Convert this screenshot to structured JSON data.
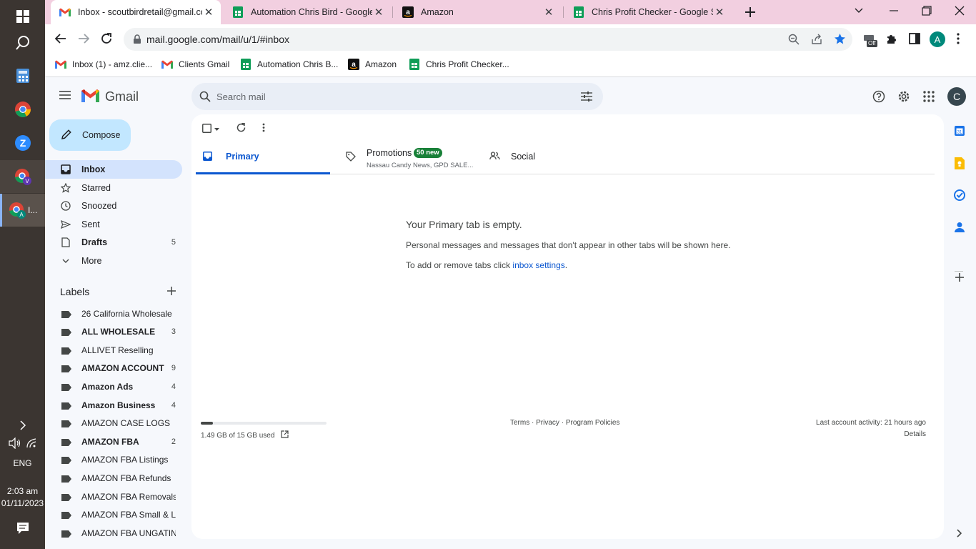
{
  "taskbar": {
    "time": "2:03 am",
    "date": "01/11/2023",
    "language": "ENG",
    "pinned_label": "I..."
  },
  "browser": {
    "tabs": [
      {
        "title": "Inbox - scoutbirdretail@gmail.com",
        "icon": "gmail-icon",
        "active": true
      },
      {
        "title": "Automation Chris Bird - Google",
        "icon": "sheets-icon",
        "active": false
      },
      {
        "title": "Amazon",
        "icon": "amazon-icon",
        "active": false
      },
      {
        "title": "Chris Profit Checker - Google Sh",
        "icon": "sheets-icon",
        "active": false
      }
    ],
    "url": "mail.google.com/mail/u/1/#inbox",
    "profile_initial": "A",
    "extension_badge": "Off",
    "bookmarks": [
      {
        "label": "Inbox (1) - amz.clie...",
        "icon": "gmail-icon"
      },
      {
        "label": "Clients Gmail",
        "icon": "gmail-icon"
      },
      {
        "label": "Automation Chris B...",
        "icon": "sheets-icon"
      },
      {
        "label": "Amazon",
        "icon": "amazon-icon"
      },
      {
        "label": "Chris Profit Checker...",
        "icon": "sheets-icon"
      }
    ]
  },
  "gmail": {
    "logo_text": "Gmail",
    "search_placeholder": "Search mail",
    "account_initial": "C",
    "compose_label": "Compose",
    "nav": [
      {
        "label": "Inbox",
        "icon": "inbox-icon",
        "count": "",
        "active": true
      },
      {
        "label": "Starred",
        "icon": "star-icon",
        "count": "",
        "active": false
      },
      {
        "label": "Snoozed",
        "icon": "clock-icon",
        "count": "",
        "active": false
      },
      {
        "label": "Sent",
        "icon": "send-icon",
        "count": "",
        "active": false
      },
      {
        "label": "Drafts",
        "icon": "draft-icon",
        "count": "5",
        "active": false
      },
      {
        "label": "More",
        "icon": "chevron-down-icon",
        "count": "",
        "active": false
      }
    ],
    "labels_heading": "Labels",
    "labels": [
      {
        "name": "26 California Wholesale",
        "count": "",
        "bold": false
      },
      {
        "name": "ALL WHOLESALE",
        "count": "3",
        "bold": true
      },
      {
        "name": "ALLIVET Reselling",
        "count": "",
        "bold": false
      },
      {
        "name": "AMAZON ACCOUNT",
        "count": "9",
        "bold": true
      },
      {
        "name": "Amazon Ads",
        "count": "4",
        "bold": true
      },
      {
        "name": "Amazon Business",
        "count": "4",
        "bold": true
      },
      {
        "name": "AMAZON CASE LOGS",
        "count": "",
        "bold": false
      },
      {
        "name": "AMAZON FBA",
        "count": "2",
        "bold": true
      },
      {
        "name": "AMAZON FBA Listings",
        "count": "",
        "bold": false
      },
      {
        "name": "AMAZON FBA Refunds",
        "count": "",
        "bold": false
      },
      {
        "name": "AMAZON FBA Removals",
        "count": "",
        "bold": false
      },
      {
        "name": "AMAZON FBA Small & Li...",
        "count": "",
        "bold": false
      },
      {
        "name": "AMAZON FBA UNGATING",
        "count": "",
        "bold": false
      }
    ],
    "inbox_tabs": {
      "primary": "Primary",
      "promotions": "Promotions",
      "promotions_badge": "50 new",
      "promotions_snippet": "Nassau Candy News, GPD SALE...",
      "social": "Social"
    },
    "empty": {
      "title": "Your Primary tab is empty.",
      "line1": "Personal messages and messages that don't appear in other tabs will be shown here.",
      "line2_prefix": "To add or remove tabs click ",
      "line2_link": "inbox settings",
      "line2_suffix": "."
    },
    "footer": {
      "storage": "1.49 GB of 15 GB used",
      "storage_fraction": 0.099,
      "terms": "Terms",
      "privacy": "Privacy",
      "policies": "Program Policies",
      "sep": " · ",
      "activity": "Last account activity: 21 hours ago",
      "details": "Details"
    }
  }
}
